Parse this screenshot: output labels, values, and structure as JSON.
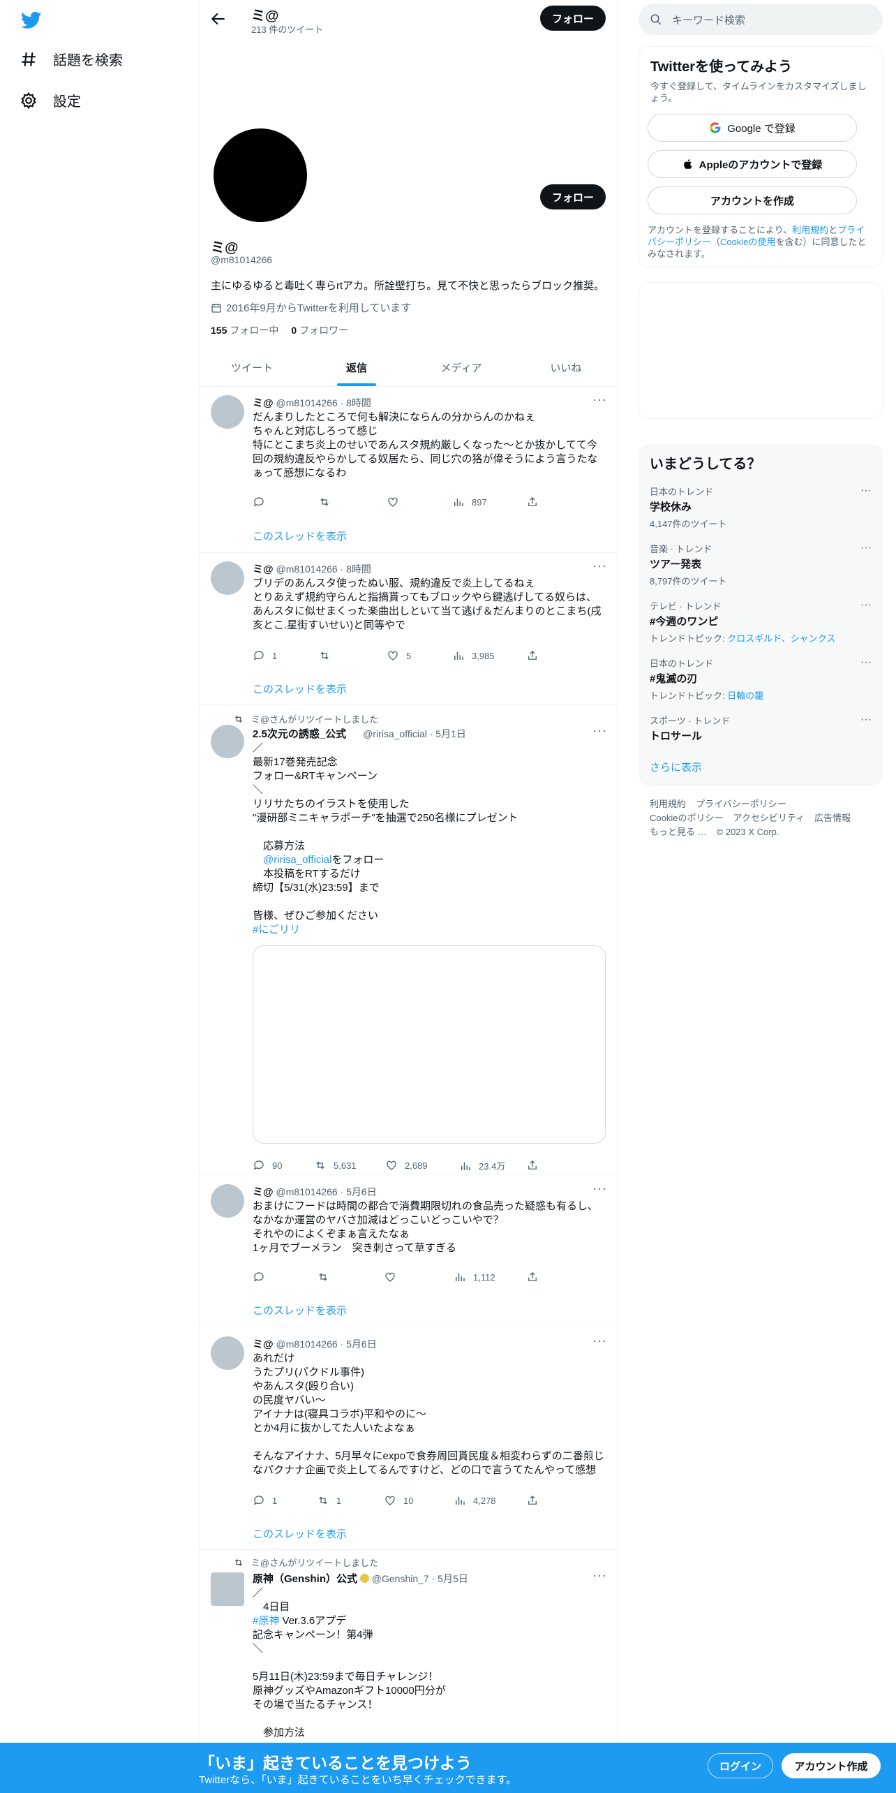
{
  "nav": {
    "explore": "話題を検索",
    "settings": "設定"
  },
  "header": {
    "name": "ミ@",
    "tweet_count": "213 件のツイート",
    "follow_button": "フォロー"
  },
  "profile": {
    "follow_button": "フォロー",
    "name": "ミ@",
    "handle": "@m81014266",
    "bio": "主にゆるゆると毒吐く専らrtアカ。所詮壁打ち。見て不快と思ったらブロック推奨。",
    "joined": "2016年9月からTwitterを利用しています",
    "following_count": "155",
    "following_label": "フォロー中",
    "followers_count": "0",
    "followers_label": "フォロワー"
  },
  "tabs": [
    {
      "label": "ツイート",
      "active": false
    },
    {
      "label": "返信",
      "active": true
    },
    {
      "label": "メディア",
      "active": false
    },
    {
      "label": "いいね",
      "active": false
    }
  ],
  "tweets": [
    {
      "name": "ミ@",
      "meta": "@m81014266 · 8時間",
      "text": "だんまりしたところで何も解決にならんの分からんのかねぇ\nちゃんと対応しろって感じ\n特にとこまち炎上のせいであんスタ規約厳しくなった〜とか抜かしてて今回の規約違反やらかしてる奴居たら、同じ穴の狢が偉そうによう言うたなぁって感想になるわ",
      "replies": "",
      "retweets": "",
      "likes": "",
      "views": "897",
      "thread": "このスレッドを表示"
    },
    {
      "name": "ミ@",
      "meta": "@m81014266 · 8時間",
      "text": "ブリデのあんスタ使ったぬい服、規約違反で炎上してるねぇ\nとりあえず規約守らんと指摘貰ってもブロックやら鍵逃げしてる奴らは、あんスタに似せまくった楽曲出しといて当て逃げ＆だんまりのとこまち(戌亥とこ.星街すいせい)と同等やで",
      "replies": "1",
      "retweets": "",
      "likes": "5",
      "views": "3,985",
      "thread": "このスレッドを表示"
    },
    {
      "retweeted_by": "ミ@さんがリツイートしました",
      "name": "2.5次元の誘惑_公式",
      "meta": "@ririsa_official · 5月1日",
      "text": "／\n最新17巻発売記念\nフォロー&RTキャンペーン\n＼\nリリサたちのイラストを使用した\n\"漫研部ミニキャラポーチ\"を抽選で250名様にプレゼント\n\n　応募方法\n　",
      "mention": "@ririsa_official",
      "text_after_mention": "をフォロー\n　本投稿をRTするだけ\n締切【5/31(水)23:59】まで\n\n皆様、ぜひご参加ください",
      "hashtag": "#にごリリ",
      "replies": "90",
      "retweets": "5,631",
      "likes": "2,689",
      "views": "23.4万"
    },
    {
      "name": "ミ@",
      "meta": "@m81014266 · 5月6日",
      "text": "おまけにフードは時間の都合で消費期限切れの食品売った疑惑も有るし、なかなか運営のヤバさ加減はどっこいどっこいやで？\nそれやのによくぞまぁ言えたなぁ\n1ヶ月でブーメラン　突き刺さって草すぎる",
      "replies": "",
      "retweets": "",
      "likes": "",
      "views": "1,112",
      "thread": "このスレッドを表示"
    },
    {
      "name": "ミ@",
      "meta": "@m81014266 · 5月6日",
      "text": "あれだけ\nうたプリ(パクドル事件)\nやあんスタ(殴り合い)\nの民度ヤバい〜\nアイナナは(寝具コラボ)平和やのに〜\nとか4月に抜かしてた人いたよなぁ\n\nそんなアイナナ、5月早々にexpoで食券周回貰民度＆相変わらずの二番煎じなパクナナ企画で炎上してるんですけど、どの口で言うてたんやって感想",
      "replies": "1",
      "retweets": "1",
      "likes": "10",
      "views": "4,278",
      "thread": "このスレッドを表示"
    },
    {
      "retweeted_by": "ミ@さんがリツイートしました",
      "name": "原神（Genshin）公式",
      "meta": "@Genshin_7 · 5月5日",
      "text_before_hashtag": "／\n　4日目\n",
      "hashtag": "#原神",
      "text": " Ver.3.6アプデ\n記念キャンペーン！第4弾\n＼\n\n5月11日(木)23:59まで毎日チャレンジ！\n原神グッズやAmazonギフト10000円分が\nその場で当たるチャンス！\n\n　参加方法"
    }
  ],
  "search": {
    "placeholder": "キーワード検索"
  },
  "signup": {
    "title": "Twitterを使ってみよう",
    "subtitle": "今すぐ登録して、タイムラインをカスタマイズしましょう。",
    "google": "Google で登録",
    "apple": "Appleのアカウントで登録",
    "create": "アカウントを作成",
    "note_1": "アカウントを登録することにより、",
    "terms": "利用規約",
    "and": "と",
    "privacy": "プライバシーポリシー",
    "note_2": "（",
    "cookie": "Cookieの使用",
    "note_3": "を含む）に同意したとみなされます。"
  },
  "trends": {
    "title": "いまどうしてる？",
    "items": [
      {
        "category": "日本のトレンド",
        "name": "学校休み",
        "sub": "4,147件のツイート"
      },
      {
        "category": "音楽 · トレンド",
        "name": "ツアー発表",
        "sub": "8,797件のツイート"
      },
      {
        "category": "テレビ · トレンド",
        "name": "#今週のワンピ",
        "sub_label": "トレンドトピック: ",
        "sub_link": "クロスギルド、シャンクス"
      },
      {
        "category": "日本のトレンド",
        "name": "#鬼滅の刃",
        "sub_label": "トレンドトピック: ",
        "sub_link": "日輪の籠"
      },
      {
        "category": "スポーツ · トレンド",
        "name": "トロサール",
        "sub": ""
      }
    ],
    "show_more": "さらに表示"
  },
  "footer": {
    "terms": "利用規約",
    "privacy": "プライバシーポリシー",
    "cookie": "Cookieのポリシー",
    "accessibility": "アクセシビリティ",
    "ads": "広告情報",
    "more": "もっと見る …",
    "copyright": "© 2023 X Corp."
  },
  "bottom": {
    "title": "「いま」起きていることを見つけよう",
    "subtitle": "Twitterなら、「いま」起きていることをいち早くチェックできます。",
    "login": "ログイン",
    "signup": "アカウント作成"
  },
  "colors": {
    "accent": "#1d9bf0",
    "text": "#0f1419",
    "muted": "#536471"
  }
}
